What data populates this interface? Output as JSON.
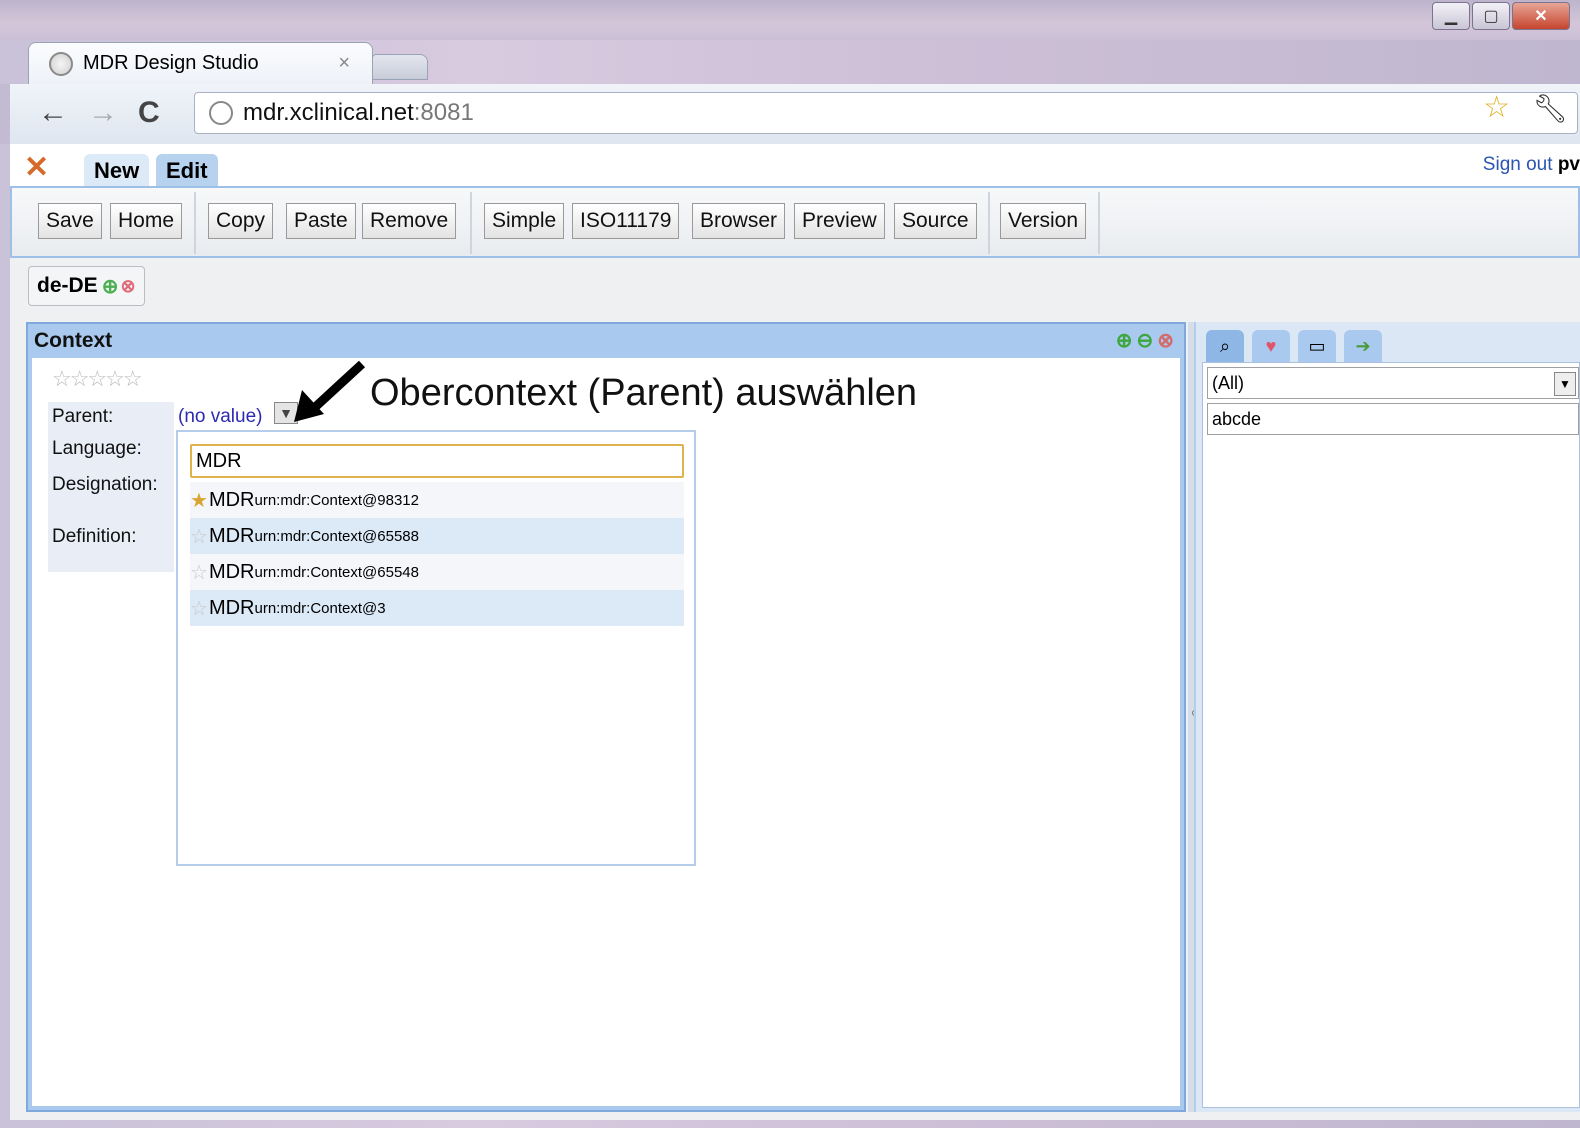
{
  "browser": {
    "tab_title": "MDR Design Studio",
    "tab_close": "×",
    "url_host": "mdr.xclinical.net",
    "url_port": ":8081",
    "window_controls": [
      "minimize-icon",
      "maximize-icon",
      "close-icon"
    ]
  },
  "app": {
    "tabs": [
      {
        "label": "New",
        "active": false
      },
      {
        "label": "Edit",
        "active": true
      }
    ],
    "signout_label": "Sign out",
    "user_partial": "pv",
    "toolbar": {
      "save": "Save",
      "home": "Home",
      "copy": "Copy",
      "paste": "Paste",
      "remove": "Remove",
      "simple": "Simple",
      "iso": "ISO11179",
      "browser": "Browser",
      "preview": "Preview",
      "source": "Source",
      "version": "Version"
    },
    "language_tag": "de-DE"
  },
  "context_panel": {
    "title": "Context",
    "rating_stars": "☆☆☆☆☆",
    "labels": {
      "parent": "Parent:",
      "language": "Language:",
      "designation": "Designation:",
      "definition": "Definition:"
    },
    "parent_value": "(no value)",
    "annotation": "Obercontext (Parent) auswählen",
    "dropdown": {
      "search_value": "MDR",
      "items": [
        {
          "name": "MDR",
          "urn": "urn:mdr:Context@98312",
          "starred": true
        },
        {
          "name": "MDR",
          "urn": "urn:mdr:Context@65588",
          "starred": false
        },
        {
          "name": "MDR",
          "urn": "urn:mdr:Context@65548",
          "starred": false
        },
        {
          "name": "MDR",
          "urn": "urn:mdr:Context@3",
          "starred": false
        }
      ]
    }
  },
  "right_panel": {
    "tab_icons": [
      "binoculars-icon",
      "heart-icon",
      "book-icon",
      "export-icon"
    ],
    "filter_value": "(All)",
    "search_value": "abcde"
  }
}
